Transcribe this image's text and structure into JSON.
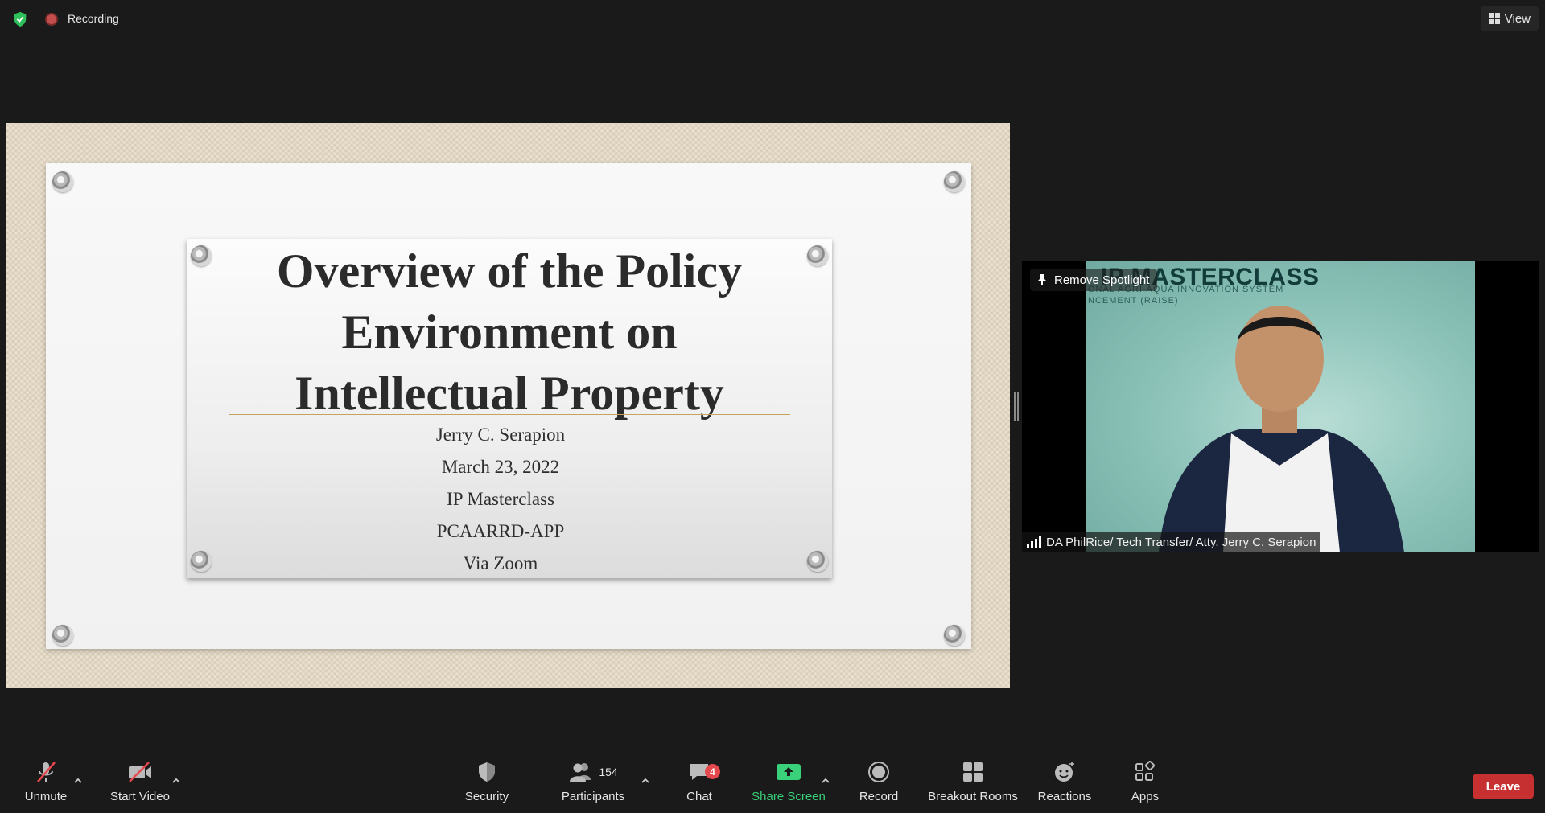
{
  "topbar": {
    "recording_label": "Recording",
    "view_label": "View"
  },
  "slide": {
    "title_lines": [
      "Overview of the Policy",
      "Environment on",
      "Intellectual Property"
    ],
    "details": [
      "Jerry C. Serapion",
      "March 23, 2022",
      "IP Masterclass",
      "PCAARRD-APP",
      "Via Zoom"
    ]
  },
  "video": {
    "banner": "IP MASTERCLASS",
    "banner_sub": "ONAL AGRI-AQUA INNOVATION SYSTEM",
    "banner_sub2": "NCEMENT (RAISE)",
    "spotlight_label": "Remove Spotlight",
    "participant_name": "DA PhilRice/ Tech Transfer/ Atty. Jerry C. Serapion"
  },
  "toolbar": {
    "unmute": "Unmute",
    "start_video": "Start Video",
    "security": "Security",
    "participants": "Participants",
    "participants_count": "154",
    "chat": "Chat",
    "chat_badge": "4",
    "share_screen": "Share Screen",
    "record": "Record",
    "breakout_rooms": "Breakout Rooms",
    "reactions": "Reactions",
    "apps": "Apps",
    "leave": "Leave"
  },
  "colors": {
    "background": "#1a1a1a",
    "share_green": "#39d17a",
    "leave_red": "#c73030",
    "badge_red": "#e5484d"
  }
}
